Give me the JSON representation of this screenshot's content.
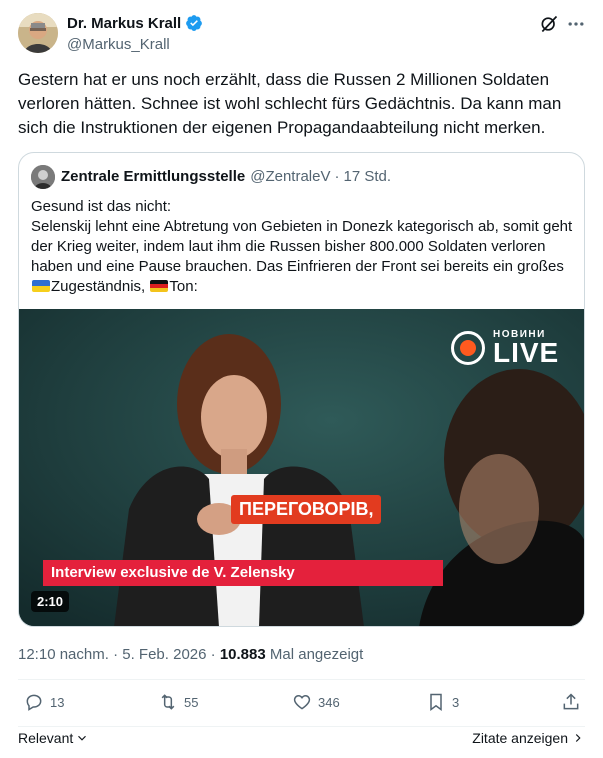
{
  "author": {
    "name": "Dr. Markus Krall",
    "handle": "@Markus_Krall"
  },
  "tweet": {
    "text": "Gestern hat er uns noch erzählt, dass die Russen 2 Millionen Soldaten verloren hätten. Schnee ist wohl schlecht fürs Gedächtnis. Da kann man sich die Instruktionen der eigenen Propagandaabteilung nicht merken."
  },
  "quote": {
    "name": "Zentrale Ermittlungsstelle",
    "handle": "@ZentraleV",
    "separator": "·",
    "time": "17 Std.",
    "line1": "Gesund ist das nicht:",
    "line2": "Selenskij lehnt eine Abtretung von Gebieten in Donezk kategorisch ab, somit geht der Krieg weiter, indem laut ihm die Russen bisher 800.000 Soldaten verloren haben und eine Pause brauchen. Das Einfrieren der Front sei bereits ein großes",
    "line2b": "Zugeständnis,",
    "line2c": "Ton:",
    "video": {
      "channel_small": "НОВИНИ",
      "channel_big": "LIVE",
      "subtitle": "ПЕРЕГОВОРІВ,",
      "lower_third": "Interview exclusive de V. Zelensky",
      "duration": "2:10"
    }
  },
  "meta": {
    "time": "12:10 nachm.",
    "dot1": "·",
    "date": "5. Feb. 2026",
    "dot2": "·",
    "views": "10.883",
    "views_label": "Mal angezeigt"
  },
  "actions": {
    "replies": "13",
    "reposts": "55",
    "likes": "346",
    "bookmarks": "3"
  },
  "footer": {
    "sort_label": "Relevant",
    "quotes_label": "Zitate anzeigen"
  },
  "colors": {
    "verified": "#1d9bf0",
    "muted": "#536471",
    "text": "#0f1419",
    "border": "#cfd9de"
  }
}
